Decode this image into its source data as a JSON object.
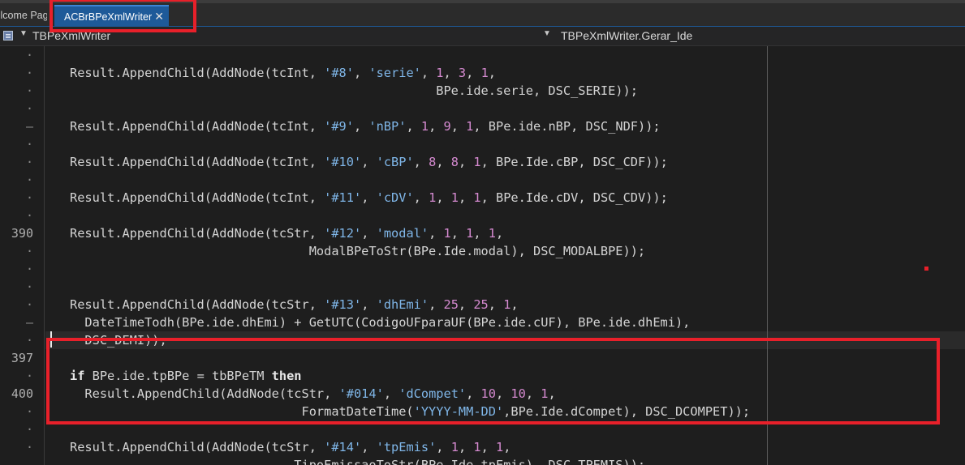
{
  "tabs": {
    "welcome_label": "Welcome Page",
    "active_label": "ACBrBPeXmlWriter",
    "close_glyph": "✕"
  },
  "nav": {
    "class_name": "TBPeXmlWriter",
    "method_name": "TBPeXmlWriter.Gerar_Ide"
  },
  "gutter": [
    "·",
    "·",
    "·",
    "·",
    "–",
    "·",
    "·",
    "·",
    "·",
    "·",
    "390",
    "·",
    "·",
    "·",
    "·",
    "–",
    "·",
    "397",
    "·",
    "400",
    "·",
    "·",
    "·"
  ],
  "code": [
    [],
    [
      [
        "t",
        "Result.AppendChild(AddNode(tcInt, "
      ],
      [
        "s",
        "'#8'"
      ],
      [
        "t",
        ", "
      ],
      [
        "s",
        "'serie'"
      ],
      [
        "t",
        ", "
      ],
      [
        "n",
        "1"
      ],
      [
        "t",
        ", "
      ],
      [
        "n",
        "3"
      ],
      [
        "t",
        ", "
      ],
      [
        "n",
        "1"
      ],
      [
        "t",
        ","
      ]
    ],
    [
      [
        "t",
        "                                                 BPe.ide.serie, DSC_SERIE));"
      ]
    ],
    [],
    [
      [
        "t",
        "Result.AppendChild(AddNode(tcInt, "
      ],
      [
        "s",
        "'#9'"
      ],
      [
        "t",
        ", "
      ],
      [
        "s",
        "'nBP'"
      ],
      [
        "t",
        ", "
      ],
      [
        "n",
        "1"
      ],
      [
        "t",
        ", "
      ],
      [
        "n",
        "9"
      ],
      [
        "t",
        ", "
      ],
      [
        "n",
        "1"
      ],
      [
        "t",
        ", BPe.ide.nBP, DSC_NDF));"
      ]
    ],
    [],
    [
      [
        "t",
        "Result.AppendChild(AddNode(tcInt, "
      ],
      [
        "s",
        "'#10'"
      ],
      [
        "t",
        ", "
      ],
      [
        "s",
        "'cBP'"
      ],
      [
        "t",
        ", "
      ],
      [
        "n",
        "8"
      ],
      [
        "t",
        ", "
      ],
      [
        "n",
        "8"
      ],
      [
        "t",
        ", "
      ],
      [
        "n",
        "1"
      ],
      [
        "t",
        ", BPe.Ide.cBP, DSC_CDF));"
      ]
    ],
    [],
    [
      [
        "t",
        "Result.AppendChild(AddNode(tcInt, "
      ],
      [
        "s",
        "'#11'"
      ],
      [
        "t",
        ", "
      ],
      [
        "s",
        "'cDV'"
      ],
      [
        "t",
        ", "
      ],
      [
        "n",
        "1"
      ],
      [
        "t",
        ", "
      ],
      [
        "n",
        "1"
      ],
      [
        "t",
        ", "
      ],
      [
        "n",
        "1"
      ],
      [
        "t",
        ", BPe.Ide.cDV, DSC_CDV));"
      ]
    ],
    [],
    [
      [
        "t",
        "Result.AppendChild(AddNode(tcStr, "
      ],
      [
        "s",
        "'#12'"
      ],
      [
        "t",
        ", "
      ],
      [
        "s",
        "'modal'"
      ],
      [
        "t",
        ", "
      ],
      [
        "n",
        "1"
      ],
      [
        "t",
        ", "
      ],
      [
        "n",
        "1"
      ],
      [
        "t",
        ", "
      ],
      [
        "n",
        "1"
      ],
      [
        "t",
        ","
      ]
    ],
    [
      [
        "t",
        "                                ModalBPeToStr(BPe.Ide.modal), DSC_MODALBPE));"
      ]
    ],
    [],
    [],
    [
      [
        "t",
        "Result.AppendChild(AddNode(tcStr, "
      ],
      [
        "s",
        "'#13'"
      ],
      [
        "t",
        ", "
      ],
      [
        "s",
        "'dhEmi'"
      ],
      [
        "t",
        ", "
      ],
      [
        "n",
        "25"
      ],
      [
        "t",
        ", "
      ],
      [
        "n",
        "25"
      ],
      [
        "t",
        ", "
      ],
      [
        "n",
        "1"
      ],
      [
        "t",
        ","
      ]
    ],
    [
      [
        "t",
        "  DateTimeTodh(BPe.ide.dhEmi) + GetUTC(CodigoUFparaUF(BPe.ide.cUF), BPe.ide.dhEmi),"
      ]
    ],
    [
      [
        "t",
        "  DSC_DEMI));"
      ]
    ],
    [],
    [
      [
        "k",
        "if"
      ],
      [
        "t",
        " BPe.ide.tpBPe = tbBPeTM "
      ],
      [
        "k",
        "then"
      ]
    ],
    [
      [
        "t",
        "  Result.AppendChild(AddNode(tcStr, "
      ],
      [
        "s",
        "'#014'"
      ],
      [
        "t",
        ", "
      ],
      [
        "s",
        "'dCompet'"
      ],
      [
        "t",
        ", "
      ],
      [
        "n",
        "10"
      ],
      [
        "t",
        ", "
      ],
      [
        "n",
        "10"
      ],
      [
        "t",
        ", "
      ],
      [
        "n",
        "1"
      ],
      [
        "t",
        ","
      ]
    ],
    [
      [
        "t",
        "                               FormatDateTime("
      ],
      [
        "s",
        "'YYYY-MM-DD'"
      ],
      [
        "t",
        ",BPe.Ide.dCompet), DSC_DCOMPET));"
      ]
    ],
    [],
    [
      [
        "t",
        "Result.AppendChild(AddNode(tcStr, "
      ],
      [
        "s",
        "'#14'"
      ],
      [
        "t",
        ", "
      ],
      [
        "s",
        "'tpEmis'"
      ],
      [
        "t",
        ", "
      ],
      [
        "n",
        "1"
      ],
      [
        "t",
        ", "
      ],
      [
        "n",
        "1"
      ],
      [
        "t",
        ", "
      ],
      [
        "n",
        "1"
      ],
      [
        "t",
        ","
      ]
    ],
    [
      [
        "t",
        "                              TipoEmissaoToStr(BPe.Ide.tpEmis), DSC_TPEMIS));"
      ]
    ]
  ],
  "colors": {
    "string": "#7fb6e8",
    "number": "#d58ad0",
    "annotation": "#e8202a",
    "tab_active": "#1e5a99"
  }
}
